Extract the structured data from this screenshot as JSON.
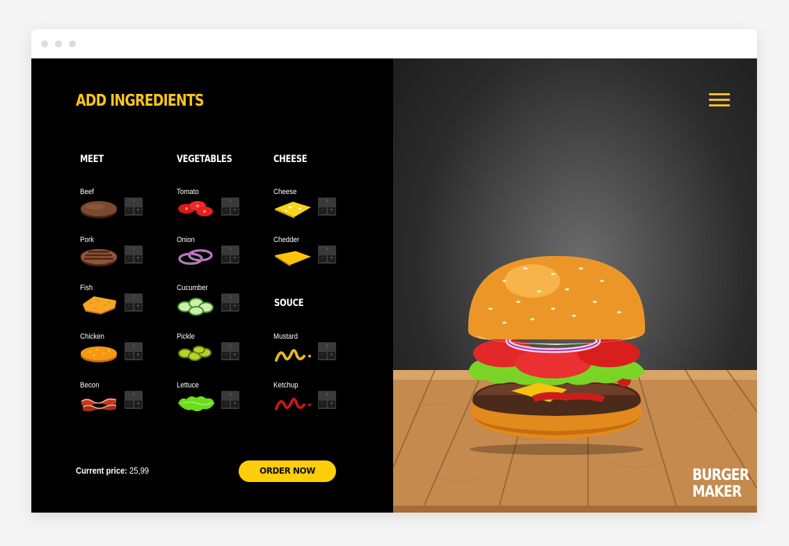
{
  "title": "ADD INGREDIENTS",
  "categories": {
    "meet": "MEET",
    "vegetables": "VEGETABLES",
    "cheese": "CHEESE",
    "souce": "SOUCE"
  },
  "meet": [
    {
      "label": "Beef",
      "qty": "1",
      "icon": "beef-patty"
    },
    {
      "label": "Pork",
      "qty": "1",
      "icon": "pork-patty"
    },
    {
      "label": "Fish",
      "qty": "1",
      "icon": "fish-fillet"
    },
    {
      "label": "Chicken",
      "qty": "1",
      "icon": "chicken-patty"
    },
    {
      "label": "Becon",
      "qty": "1",
      "icon": "bacon-strips"
    }
  ],
  "vegetables": [
    {
      "label": "Tomato",
      "qty": "1",
      "icon": "tomato-slices"
    },
    {
      "label": "Onion",
      "qty": "1",
      "icon": "onion-rings"
    },
    {
      "label": "Cucumber",
      "qty": "1",
      "icon": "cucumber-slices"
    },
    {
      "label": "Pickle",
      "qty": "1",
      "icon": "pickle-slices"
    },
    {
      "label": "Lettuce",
      "qty": "1",
      "icon": "lettuce-leaf"
    }
  ],
  "cheese": [
    {
      "label": "Cheese",
      "qty": "1",
      "icon": "cheese-slice"
    },
    {
      "label": "Chedder",
      "qty": "1",
      "icon": "chedder-slice"
    }
  ],
  "souce": [
    {
      "label": "Mustard",
      "qty": "1",
      "icon": "mustard-squiggle"
    },
    {
      "label": "Ketchup",
      "qty": "1",
      "icon": "ketchup-squiggle"
    }
  ],
  "stepper": {
    "minus": "-",
    "plus": "+"
  },
  "footer": {
    "price_label": "Current price:",
    "price_value": "25,99",
    "order_label": "ORDER NOW"
  },
  "brand": {
    "line1": "BURGER",
    "line2": "MAKER"
  },
  "colors": {
    "accent": "#f7c51b",
    "button": "#fece0a",
    "panel": "#000000"
  }
}
